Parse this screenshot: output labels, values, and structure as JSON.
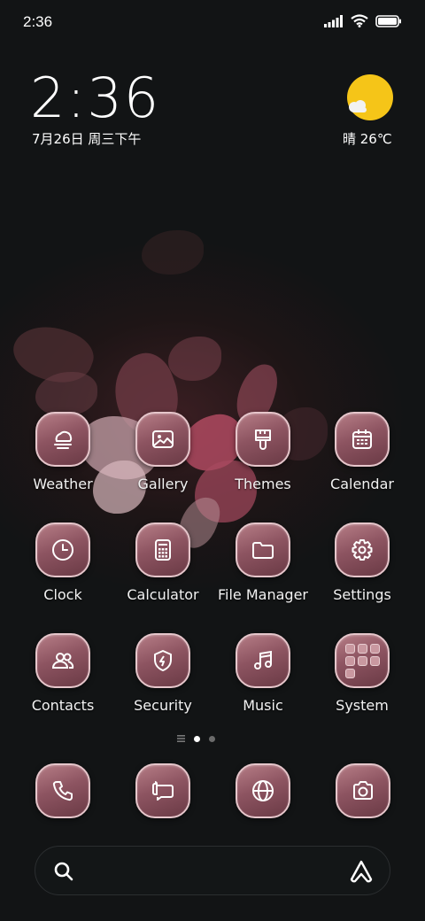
{
  "status_bar": {
    "time": "2:36",
    "icons": [
      "signal-icon",
      "wifi-icon",
      "battery-icon"
    ]
  },
  "clock_widget": {
    "time": "2:36",
    "date": "7月26日 周三下午"
  },
  "weather_widget": {
    "condition_icon": "sun-cloud-icon",
    "text": "晴 26℃"
  },
  "apps": [
    {
      "label": "Weather",
      "icon": "weather-icon"
    },
    {
      "label": "Gallery",
      "icon": "gallery-icon"
    },
    {
      "label": "Themes",
      "icon": "themes-icon"
    },
    {
      "label": "Calendar",
      "icon": "calendar-icon"
    },
    {
      "label": "Clock",
      "icon": "clock-icon"
    },
    {
      "label": "Calculator",
      "icon": "calculator-icon"
    },
    {
      "label": "File Manager",
      "icon": "folder-icon"
    },
    {
      "label": "Settings",
      "icon": "gear-icon"
    },
    {
      "label": "Contacts",
      "icon": "contacts-icon"
    },
    {
      "label": "Security",
      "icon": "shield-icon"
    },
    {
      "label": "Music",
      "icon": "music-icon"
    },
    {
      "label": "System",
      "icon": "app-folder-icon"
    }
  ],
  "page_indicator": {
    "pages": 3,
    "current": 2
  },
  "dock": [
    {
      "icon": "phone-icon"
    },
    {
      "icon": "messages-icon"
    },
    {
      "icon": "browser-icon"
    },
    {
      "icon": "camera-icon"
    }
  ],
  "search_bar": {
    "left_icon": "search-icon",
    "right_icon": "assistant-icon"
  },
  "colors": {
    "icon_fill": "#8d5461",
    "icon_border": "#e6c6cb",
    "sun": "#f5c518",
    "background": "#0e1112"
  }
}
